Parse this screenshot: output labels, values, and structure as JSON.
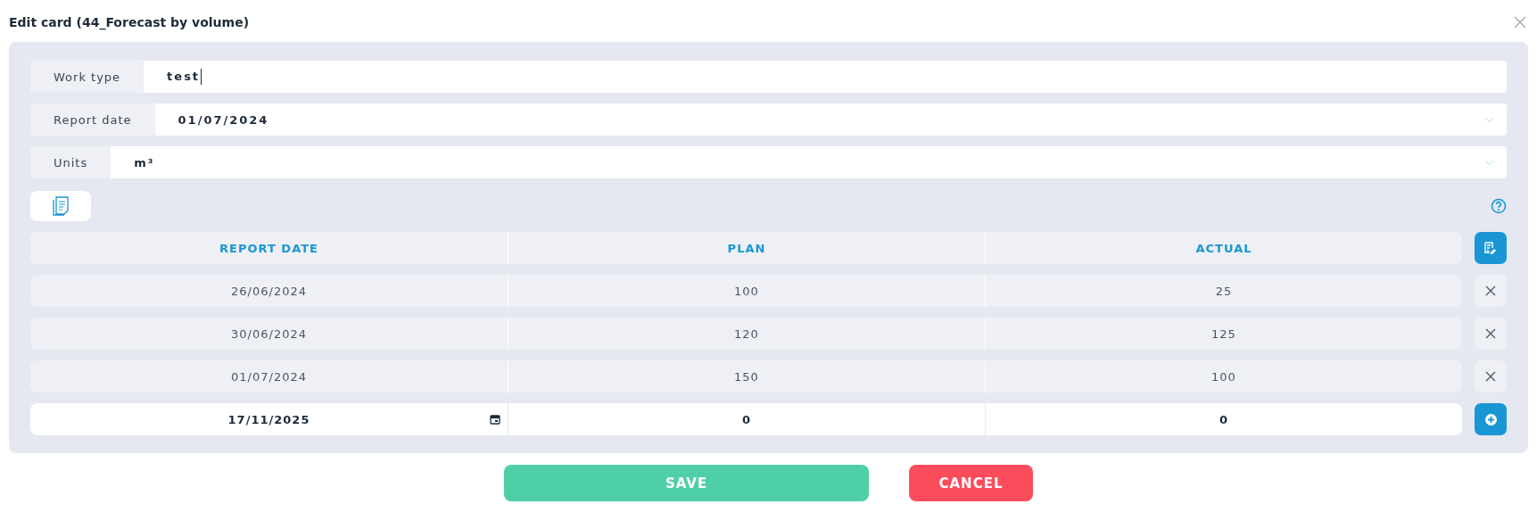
{
  "window": {
    "title": "Edit card (44_Forecast by volume)"
  },
  "fields": [
    {
      "kind": "text",
      "label": "Work type",
      "value": "test"
    },
    {
      "kind": "select",
      "label": "Report date",
      "value": "01/07/2024"
    },
    {
      "kind": "select",
      "label": "Units",
      "value": "m³"
    }
  ],
  "table": {
    "columns": [
      "REPORT DATE",
      "PLAN",
      "ACTUAL"
    ],
    "rows": [
      [
        "26/06/2024",
        "100",
        "25"
      ],
      [
        "30/06/2024",
        "120",
        "125"
      ],
      [
        "01/07/2024",
        "150",
        "100"
      ]
    ],
    "new_row": {
      "date": "17/11/2025",
      "plan": "0",
      "actual": "0"
    }
  },
  "buttons": [
    {
      "kind": "save",
      "label": "SAVE"
    },
    {
      "kind": "cancel",
      "label": "CANCEL"
    }
  ]
}
